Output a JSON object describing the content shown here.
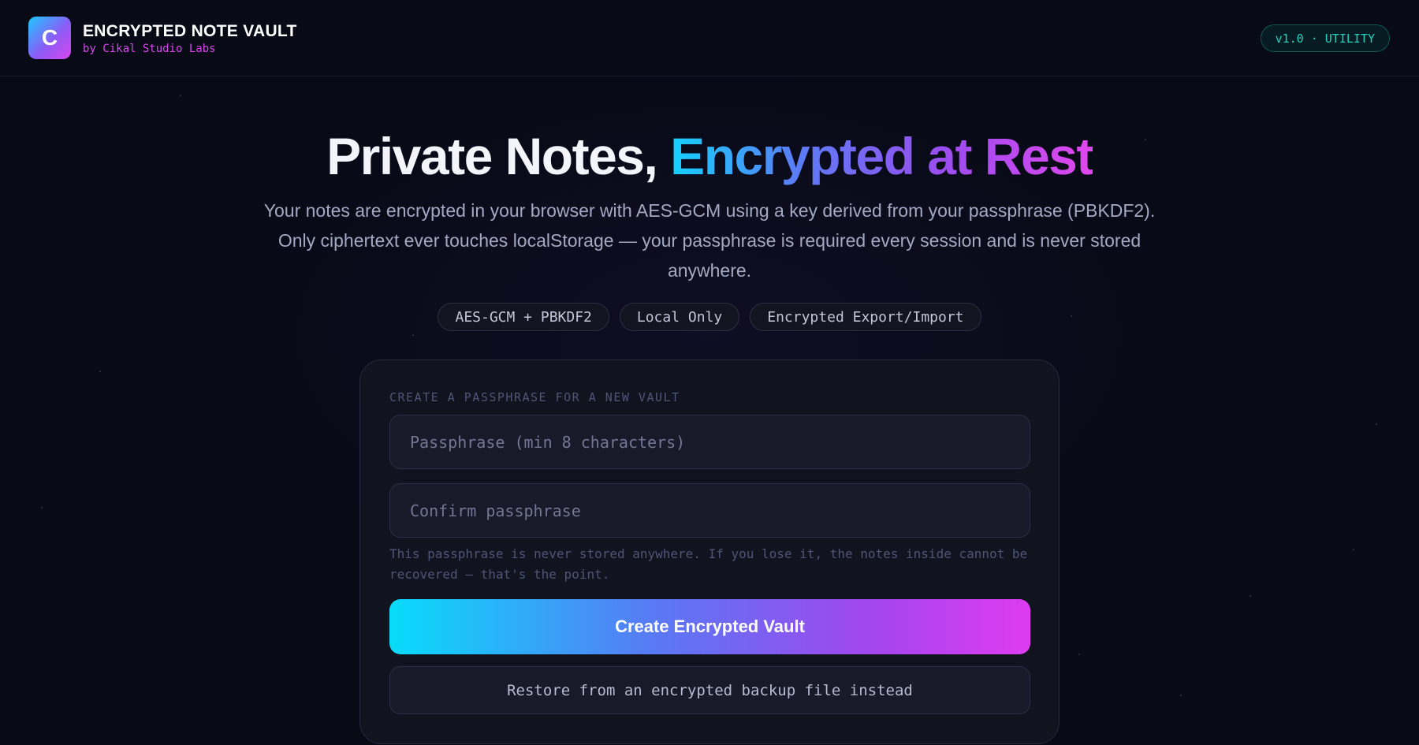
{
  "header": {
    "logo_letter": "C",
    "app_name": "ENCRYPTED NOTE VAULT",
    "byline": "by Cikal Studio Labs",
    "version_badge": "v1.0 · UTILITY"
  },
  "hero": {
    "title_plain": "Private Notes, ",
    "title_gradient": "Encrypted at Rest",
    "description": "Your notes are encrypted in your browser with AES-GCM using a key derived from your passphrase (PBKDF2). Only ciphertext ever touches localStorage — your passphrase is required every session and is never stored anywhere.",
    "chips": [
      "AES-GCM + PBKDF2",
      "Local Only",
      "Encrypted Export/Import"
    ]
  },
  "vault_form": {
    "section_label": "CREATE A PASSPHRASE FOR A NEW VAULT",
    "passphrase_value": "",
    "passphrase_placeholder": "Passphrase (min 8 characters)",
    "confirm_value": "",
    "confirm_placeholder": "Confirm passphrase",
    "hint": "This passphrase is never stored anywhere. If you lose it, the notes inside cannot be recovered — that's the point.",
    "create_button": "Create Encrypted Vault",
    "restore_button": "Restore from an encrypted backup file instead"
  },
  "colors": {
    "background": "#080a16",
    "accent_cyan": "#14d2ff",
    "accent_magenta": "#d946ef",
    "badge_teal": "#1fd1bd"
  }
}
